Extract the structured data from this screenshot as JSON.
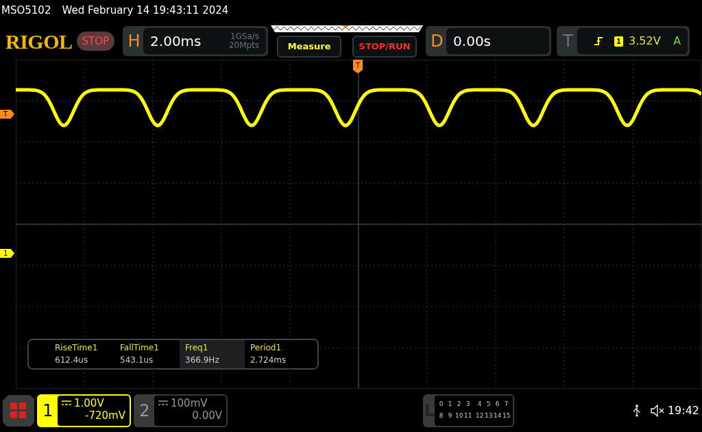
{
  "header": {
    "model": "MSO5102",
    "datetime": "Wed February 14 19:43:11 2024"
  },
  "logo": "RIGOL",
  "run_state": "STOP",
  "horizontal": {
    "label": "H",
    "timebase": "2.00ms",
    "sample_rate": "1GSa/s",
    "memory_depth": "20Mpts"
  },
  "buttons": [
    {
      "label": "Measure",
      "kind": "menu"
    },
    {
      "label": "STOP/RUN",
      "kind": "run"
    }
  ],
  "delay": {
    "label": "D",
    "value": "0.00s"
  },
  "trigger": {
    "label": "T",
    "source": "1",
    "level": "3.52V",
    "mode": "A"
  },
  "screen": {
    "top_marker": "T",
    "markers": [
      {
        "label": "T",
        "kind": "trigger"
      },
      {
        "label": "1",
        "kind": "channel"
      }
    ]
  },
  "measurements": [
    {
      "name": "RiseTime1",
      "value": "612.4us",
      "selected": false
    },
    {
      "name": "FallTime1",
      "value": "543.1us",
      "selected": false
    },
    {
      "name": "Freq1",
      "value": "366.9Hz",
      "selected": true
    },
    {
      "name": "Period1",
      "value": "2.724ms",
      "selected": false
    }
  ],
  "channels": [
    {
      "number": "1",
      "scale": "1.00V",
      "offset": "-720mV",
      "active": true
    },
    {
      "number": "2",
      "scale": "100mV",
      "offset": "0.00V",
      "active": false
    }
  ],
  "logic": {
    "label": "L",
    "rows": [
      [
        "0",
        "1",
        "2",
        "3",
        "4",
        "5",
        "6",
        "7"
      ],
      [
        "8",
        "9",
        "10",
        "11",
        "12",
        "13",
        "14",
        "15"
      ]
    ]
  },
  "status": {
    "time": "19:42"
  }
}
